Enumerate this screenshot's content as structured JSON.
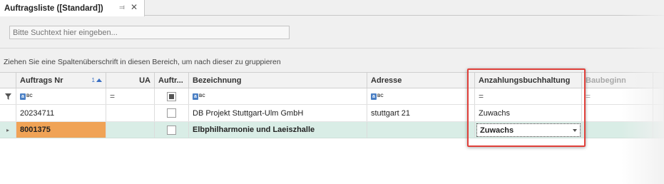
{
  "tab": {
    "title": "Auftragsliste ([Standard])",
    "pin_icon": "pin-icon",
    "close_icon": "close-icon"
  },
  "search": {
    "placeholder": "Bitte Suchtext hier eingeben..."
  },
  "group_panel": {
    "hint": "Ziehen Sie eine Spaltenüberschrift in diesen Bereich, um nach dieser zu gruppieren"
  },
  "columns": [
    {
      "label": "Auftrags Nr",
      "sort_index": "1",
      "sort": "ascending"
    },
    {
      "label": "UA"
    },
    {
      "label": "Auftr..."
    },
    {
      "label": "Bezeichnung"
    },
    {
      "label": "Adresse"
    },
    {
      "label": "Anzahlungsbuchhaltung"
    },
    {
      "label": "Baubeginn"
    }
  ],
  "filter_row": {
    "text_filter_icon": "abc-filter-icon",
    "equals_icon": "equals-icon",
    "funnel_icon": "filter-funnel-icon"
  },
  "rows": [
    {
      "auftrags_nr": "20234711",
      "ua": "",
      "auftr_checked": false,
      "bezeichnung": "DB Projekt Stuttgart-Ulm GmbH",
      "adresse": "stuttgart 21",
      "anzahlungsbuchhaltung": "Zuwachs",
      "baubeginn": ""
    },
    {
      "auftrags_nr": "8001375",
      "ua": "",
      "auftr_checked": false,
      "bezeichnung": "Elbphilharmonie und Laeiszhalle",
      "adresse": "",
      "anzahlungsbuchhaltung": "Zuwachs",
      "baubeginn": "",
      "selected": true
    }
  ],
  "colors": {
    "selected_row": "#d9ede6",
    "highlight_cell": "#f0a356",
    "annotation_border": "#e0403a"
  }
}
